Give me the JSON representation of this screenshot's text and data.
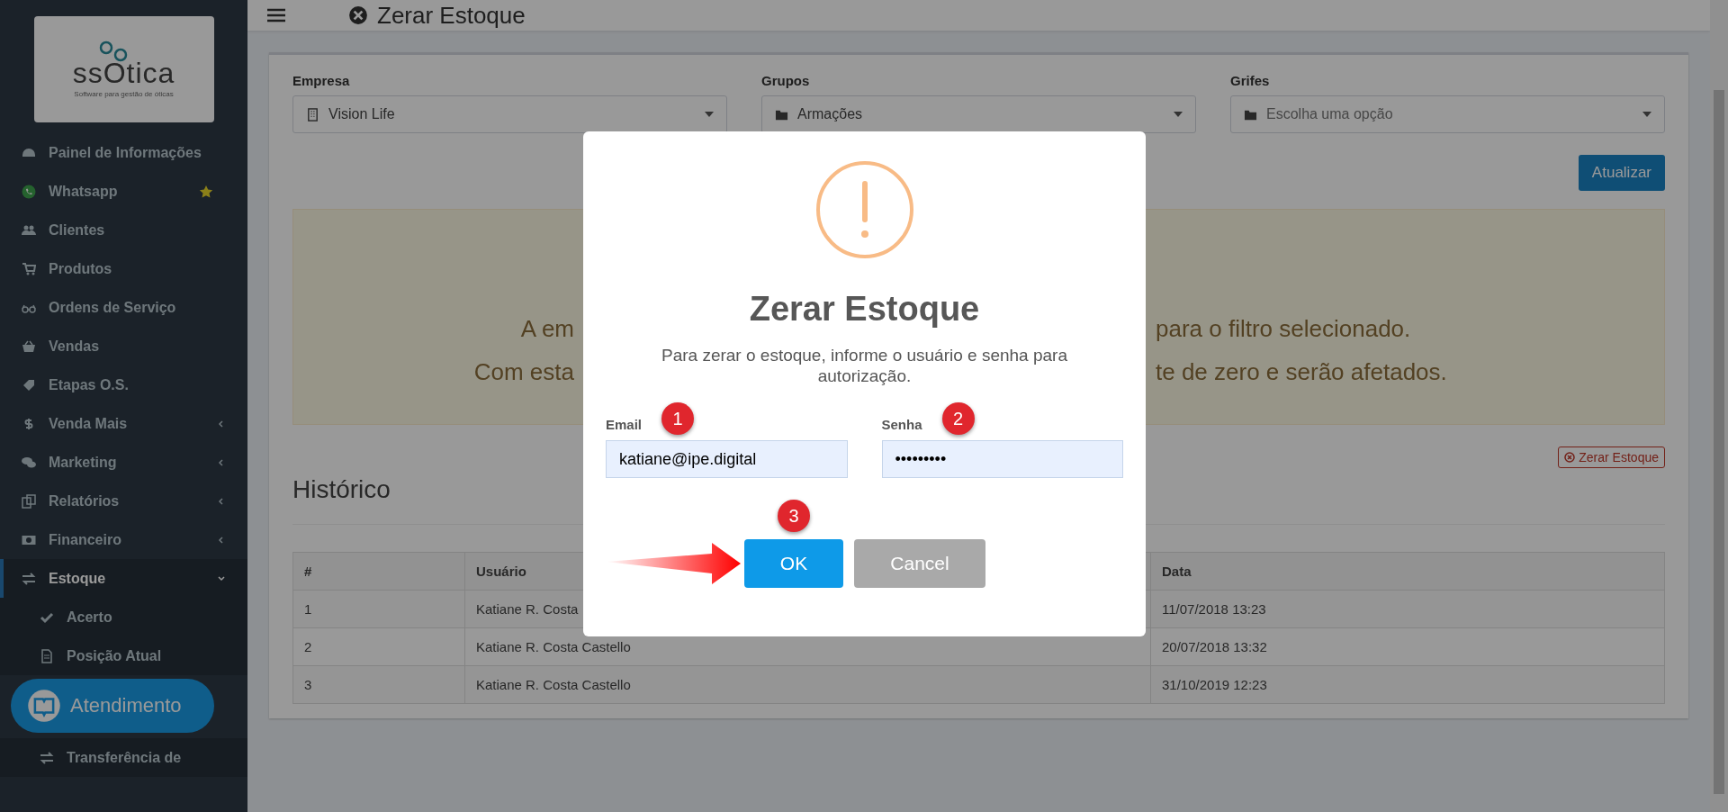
{
  "sidebar": {
    "logo": {
      "name": "ssOtica",
      "tagline": "Software para gestão de óticas"
    },
    "items": [
      {
        "label": "Painel de Informações",
        "kind": "link",
        "selected": false,
        "starred": false
      },
      {
        "label": "Whatsapp",
        "kind": "link",
        "selected": false,
        "starred": true
      },
      {
        "label": "Clientes",
        "kind": "link",
        "selected": false,
        "starred": false
      },
      {
        "label": "Produtos",
        "kind": "link",
        "selected": false,
        "starred": false
      },
      {
        "label": "Ordens de Serviço",
        "kind": "link",
        "selected": false,
        "starred": false
      },
      {
        "label": "Vendas",
        "kind": "link",
        "selected": false,
        "starred": false
      },
      {
        "label": "Etapas O.S.",
        "kind": "link",
        "selected": false,
        "starred": false
      },
      {
        "label": "Venda Mais",
        "kind": "menu",
        "expanded": false,
        "selected": false,
        "starred": false
      },
      {
        "label": "Marketing",
        "kind": "menu",
        "expanded": false,
        "selected": false,
        "starred": false
      },
      {
        "label": "Relatórios",
        "kind": "menu",
        "expanded": false,
        "selected": false,
        "starred": false
      },
      {
        "label": "Financeiro",
        "kind": "menu",
        "expanded": false,
        "selected": false,
        "starred": false
      },
      {
        "label": "Estoque",
        "kind": "menu",
        "expanded": true,
        "selected": true,
        "starred": false
      },
      {
        "label": "Acerto",
        "kind": "subitem",
        "selected": false,
        "starred": false
      },
      {
        "label": "Posição Atual",
        "kind": "subitem",
        "selected": false,
        "starred": false
      },
      {
        "label": "Transferência de",
        "kind": "subitem",
        "selected": false,
        "starred": false
      }
    ],
    "chat_button": "Atendimento"
  },
  "header": {
    "title": "Zerar Estoque"
  },
  "filters": [
    {
      "label": "Empresa",
      "value": "Vision Life"
    },
    {
      "label": "Grupos",
      "value": "Armações"
    },
    {
      "label": "Grifes",
      "placeholder": "Escolha uma opção"
    }
  ],
  "update_button": "Atualizar",
  "alert": {
    "lines": [
      {
        "start": "A em",
        "end": "para o filtro selecionado."
      },
      {
        "start": "Com esta",
        "end": "te de zero e serão afetados."
      }
    ]
  },
  "zero_button": "Zerar Estoque",
  "history": {
    "title": "Histórico",
    "columns": [
      "#",
      "Usuário",
      "Data"
    ],
    "rows": [
      [
        "1",
        "Katiane R. Costa",
        "11/07/2018 13:23"
      ],
      [
        "2",
        "Katiane R. Costa Castello",
        "20/07/2018 13:32"
      ],
      [
        "3",
        "Katiane R. Costa Castello",
        "31/10/2019 12:23"
      ]
    ]
  },
  "modal": {
    "title": "Zerar Estoque",
    "message": "Para zerar o estoque, informe o usuário e senha para autorização.",
    "fields": [
      {
        "label": "Email",
        "value": "katiane@ipe.digital",
        "step": "1"
      },
      {
        "label": "Senha",
        "value": "•••••••••",
        "step": "2"
      }
    ],
    "buttons": [
      {
        "label": "OK",
        "kind": "primary",
        "step": "3"
      },
      {
        "label": "Cancel",
        "kind": "secondary"
      }
    ]
  }
}
